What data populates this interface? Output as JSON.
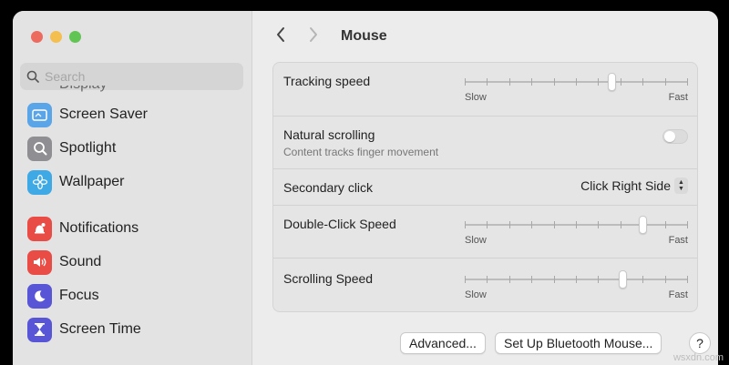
{
  "window": {
    "title": "Mouse",
    "nav": {
      "back_icon": "chevron-left-icon",
      "forward_icon": "chevron-right-icon"
    }
  },
  "sidebar": {
    "search_placeholder": "Search",
    "partial_item_label": "Display",
    "items": [
      {
        "label": "Screen Saver",
        "icon": "screen-saver-icon",
        "color": "#5aa5e8"
      },
      {
        "label": "Spotlight",
        "icon": "magnifier-icon",
        "color": "#8e8e93"
      },
      {
        "label": "Wallpaper",
        "icon": "flower-icon",
        "color": "#3fa9e6"
      },
      {
        "label": "Notifications",
        "icon": "bell-icon",
        "color": "#e84c45"
      },
      {
        "label": "Sound",
        "icon": "speaker-icon",
        "color": "#e84c45"
      },
      {
        "label": "Focus",
        "icon": "moon-icon",
        "color": "#5856d6"
      },
      {
        "label": "Screen Time",
        "icon": "hourglass-icon",
        "color": "#5856d6"
      }
    ]
  },
  "settings": {
    "tracking_speed": {
      "label": "Tracking speed",
      "min_label": "Slow",
      "max_label": "Fast",
      "value_fraction": 0.66
    },
    "natural_scrolling": {
      "label": "Natural scrolling",
      "description": "Content tracks finger movement",
      "enabled": false
    },
    "secondary_click": {
      "label": "Secondary click",
      "value": "Click Right Side"
    },
    "double_click_speed": {
      "label": "Double-Click Speed",
      "min_label": "Slow",
      "max_label": "Fast",
      "value_fraction": 0.8
    },
    "scrolling_speed": {
      "label": "Scrolling Speed",
      "min_label": "Slow",
      "max_label": "Fast",
      "value_fraction": 0.71
    }
  },
  "footer": {
    "advanced_label": "Advanced...",
    "bluetooth_label": "Set Up Bluetooth Mouse...",
    "help_label": "?"
  },
  "watermark": "wsxdn.com"
}
